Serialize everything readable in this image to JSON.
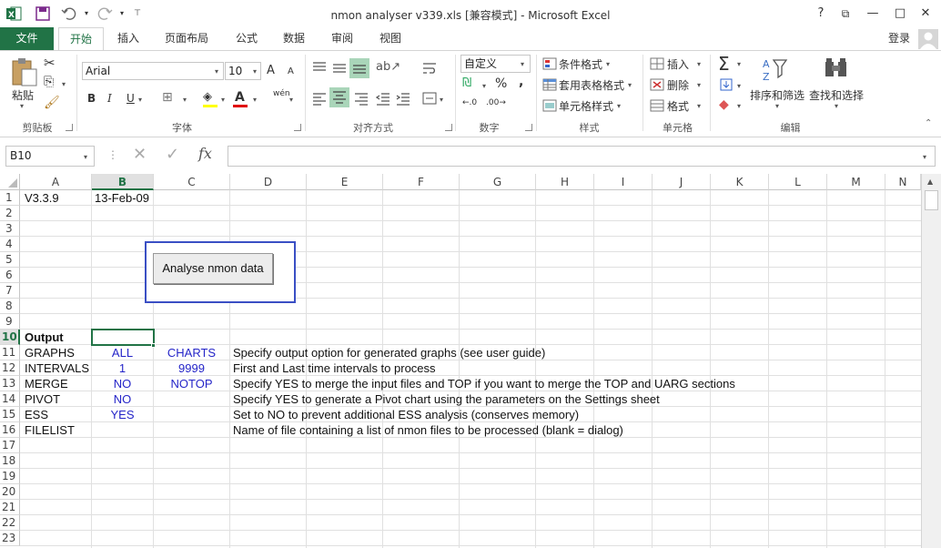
{
  "window": {
    "title": "nmon analyser v339.xls  [兼容模式] - Microsoft Excel",
    "help": "?",
    "minimize": "—",
    "restore": "□",
    "close": "✕"
  },
  "tabs": [
    "文件",
    "开始",
    "插入",
    "页面布局",
    "公式",
    "数据",
    "审阅",
    "视图"
  ],
  "login": "登录",
  "ribbon": {
    "clipboard": {
      "paste": "粘贴",
      "label": "剪贴板"
    },
    "font": {
      "name": "Arial",
      "size": "10",
      "bold": "B",
      "italic": "I",
      "underline": "U",
      "grow": "A",
      "shrink": "A",
      "wen": "wén",
      "label": "字体"
    },
    "align": {
      "label": "对齐方式"
    },
    "number": {
      "format": "自定义",
      "percent": "%",
      "comma": ",",
      "label": "数字"
    },
    "styles": {
      "conditional": "条件格式",
      "table": "套用表格格式",
      "cell": "单元格样式",
      "label": "样式"
    },
    "cells": {
      "insert": "插入",
      "delete": "删除",
      "format": "格式",
      "label": "单元格"
    },
    "editing": {
      "sort": "排序和筛选",
      "find": "查找和选择",
      "label": "编辑"
    }
  },
  "formula": {
    "namebox": "B10",
    "fx": "fx",
    "value": ""
  },
  "columns": [
    "A",
    "B",
    "C",
    "D",
    "E",
    "F",
    "G",
    "H",
    "I",
    "J",
    "K",
    "L",
    "M",
    "N"
  ],
  "rows": [
    "1",
    "2",
    "3",
    "4",
    "5",
    "6",
    "7",
    "8",
    "9",
    "10",
    "11",
    "12",
    "13",
    "14",
    "15",
    "16",
    "17",
    "18",
    "19",
    "20",
    "21",
    "22",
    "23"
  ],
  "selected_cell": "B10",
  "button": {
    "label": "Analyse nmon data"
  },
  "cells": {
    "a1": "V3.3.9",
    "b1": "13-Feb-09",
    "a10": "Output",
    "a11": "GRAPHS",
    "b11": "ALL",
    "c11": "CHARTS",
    "d11": "Specify output option for generated graphs (see user guide)",
    "a12": "INTERVALS",
    "b12": "1",
    "c12": "9999",
    "d12": "First and Last time intervals to process",
    "a13": "MERGE",
    "b13": "NO",
    "c13": "NOTOP",
    "d13": "Specify YES to merge the input files and TOP if you want to merge the TOP and UARG sections",
    "a14": "PIVOT",
    "b14": "NO",
    "d14": "Specify YES to generate a Pivot chart using the parameters on the Settings sheet",
    "a15": "ESS",
    "b15": "YES",
    "d15": "Set to NO to prevent additional ESS analysis (conserves memory)",
    "a16": "FILELIST",
    "d16": "Name of file containing a list of nmon files to be processed (blank = dialog)"
  },
  "colors": {
    "excel_green": "#217346",
    "value_blue": "#2525c8",
    "button_outline": "#3a4fc4"
  }
}
